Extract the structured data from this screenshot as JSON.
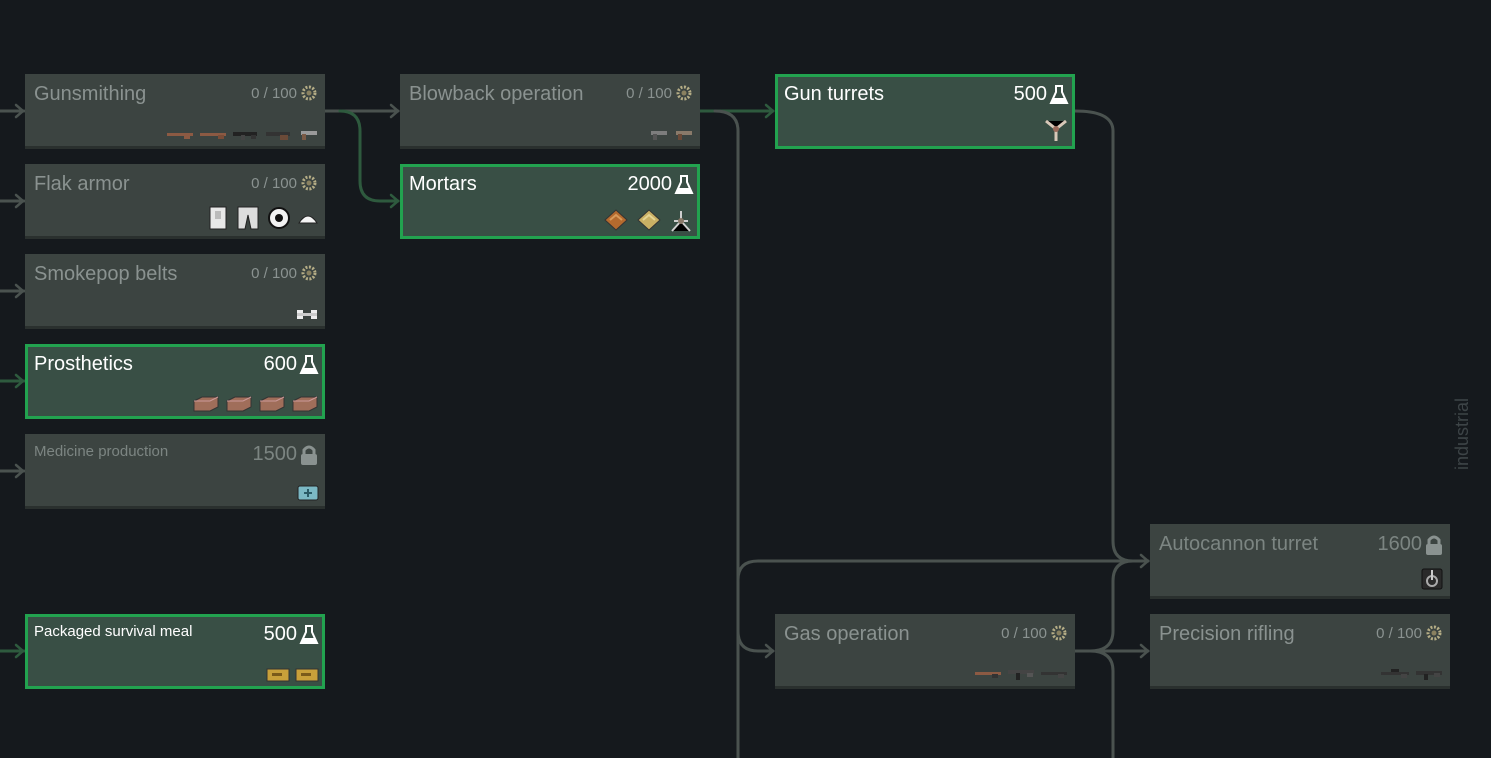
{
  "tab_label": "industrial",
  "colors": {
    "background": "#15191d",
    "node": "#3c4441",
    "node_available": "#394f45",
    "available_border": "#22a24f",
    "connector": "#4a524f",
    "connector_active": "#2e5a3e"
  },
  "research": [
    {
      "key": "gunsmithing",
      "name": "Gunsmithing",
      "status": "in-progress",
      "cost": "0 / 100",
      "cost_icon": "gear-icon",
      "items": [
        "rifle-icon",
        "rifle-icon",
        "smg-icon",
        "shotgun-icon",
        "revolver-icon"
      ]
    },
    {
      "key": "flak_armor",
      "name": "Flak armor",
      "status": "in-progress",
      "cost": "0 / 100",
      "cost_icon": "gear-icon",
      "items": [
        "flak-vest-icon",
        "flak-pants-icon",
        "flak-jacket-icon",
        "helmet-icon"
      ]
    },
    {
      "key": "smokepop_belts",
      "name": "Smokepop belts",
      "status": "in-progress",
      "cost": "0 / 100",
      "cost_icon": "gear-icon",
      "items": [
        "smokepop-belt-icon"
      ]
    },
    {
      "key": "prosthetics",
      "name": "Prosthetics",
      "status": "available",
      "cost": "600",
      "cost_icon": "flask-icon",
      "items": [
        "prosthetic-icon",
        "prosthetic-icon",
        "prosthetic-icon",
        "prosthetic-icon"
      ]
    },
    {
      "key": "medicine_production",
      "name": "Medicine production",
      "status": "locked",
      "cost": "1500",
      "cost_icon": "lock-icon",
      "items": [
        "medicine-kit-icon"
      ]
    },
    {
      "key": "packaged_survival_meal",
      "name": "Packaged survival meal",
      "status": "available",
      "cost": "500",
      "cost_icon": "flask-icon",
      "items": [
        "survival-meal-icon",
        "survival-meal-icon"
      ]
    },
    {
      "key": "blowback_operation",
      "name": "Blowback operation",
      "status": "in-progress",
      "cost": "0 / 100",
      "cost_icon": "gear-icon",
      "items": [
        "pistol-icon",
        "pistol-icon"
      ]
    },
    {
      "key": "mortars",
      "name": "Mortars",
      "status": "available",
      "cost": "2000",
      "cost_icon": "flask-icon",
      "items": [
        "mortar-shell-icon",
        "mortar-shell-icon",
        "mortar-icon"
      ]
    },
    {
      "key": "gun_turrets",
      "name": "Gun turrets",
      "status": "available",
      "cost": "500",
      "cost_icon": "flask-icon",
      "items": [
        "turret-icon"
      ]
    },
    {
      "key": "gas_operation",
      "name": "Gas operation",
      "status": "in-progress",
      "cost": "0 / 100",
      "cost_icon": "gear-icon",
      "items": [
        "rifle-icon",
        "assault-rifle-icon",
        "rifle-icon"
      ]
    },
    {
      "key": "autocannon_turret",
      "name": "Autocannon turret",
      "status": "locked",
      "cost": "1600",
      "cost_icon": "lock-icon",
      "items": [
        "autocannon-icon"
      ]
    },
    {
      "key": "precision_rifling",
      "name": "Precision rifling",
      "status": "in-progress",
      "cost": "0 / 100",
      "cost_icon": "gear-icon",
      "items": [
        "sniper-rifle-icon",
        "rifle-icon"
      ]
    }
  ]
}
